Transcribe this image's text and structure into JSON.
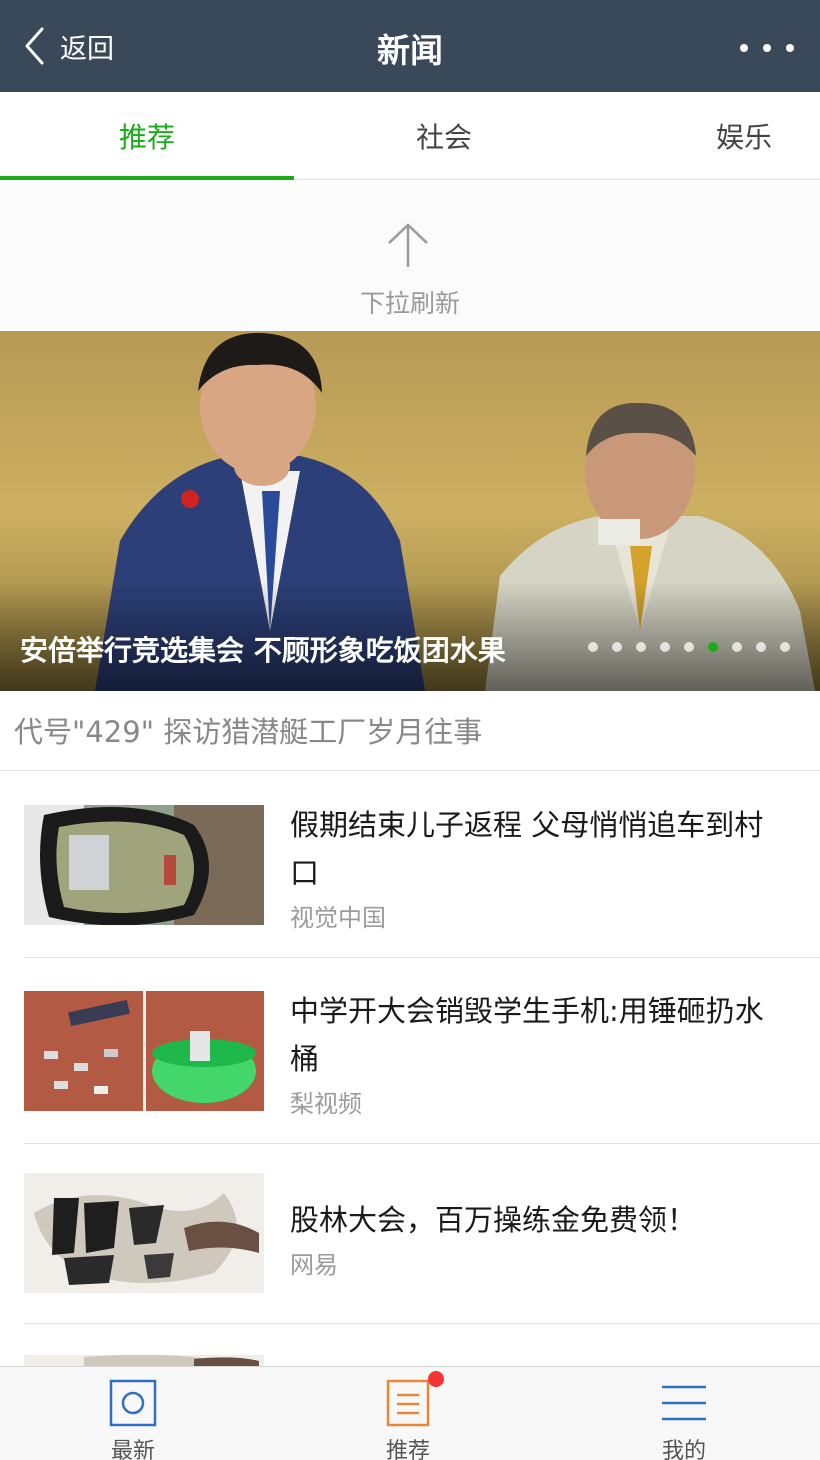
{
  "header": {
    "back_label": "返回",
    "title": "新闻"
  },
  "tabs": [
    {
      "label": "推荐",
      "active": true
    },
    {
      "label": "社会",
      "active": false
    },
    {
      "label": "娱乐",
      "active": false
    }
  ],
  "pull_refresh": {
    "text": "下拉刷新"
  },
  "banner": {
    "caption": "安倍举行竞选集会 不顾形象吃饭团水果",
    "slide_count": 9,
    "active_slide": 6
  },
  "subheadline": "代号\"429\" 探访猎潜艇工厂岁月往事",
  "news": [
    {
      "title": "假期结束儿子返程 父母悄悄追车到村口",
      "source": "视觉中国"
    },
    {
      "title": "中学开大会销毁学生手机:用锤砸扔水桶",
      "source": "梨视频"
    },
    {
      "title": "股林大会，百万操练金免费领！",
      "source": "网易"
    }
  ],
  "tabbar": [
    {
      "label": "最新",
      "icon": "square-circle-icon"
    },
    {
      "label": "推荐",
      "icon": "document-icon",
      "badge": true
    },
    {
      "label": "我的",
      "icon": "menu-lines-icon"
    }
  ],
  "colors": {
    "nav_bg": "#3a4959",
    "accent_green": "#1aad19",
    "badge_red": "#f43530",
    "icon_blue": "#2f6fc4",
    "icon_orange": "#e8863a"
  }
}
